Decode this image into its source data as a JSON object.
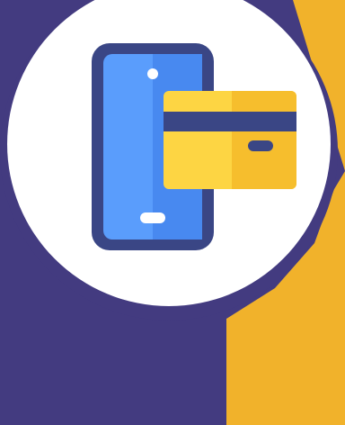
{
  "illustration": {
    "icon": "mobile-card-payment-icon",
    "elements": [
      "smartphone-icon",
      "credit-card-icon"
    ]
  },
  "colors": {
    "background_purple": "#433b80",
    "accent_yellow": "#f1b22b",
    "circle_white": "#ffffff",
    "phone_frame": "#3a4685",
    "phone_screen": "#5a9dfc",
    "phone_screen_shade": "#4889f0",
    "card_yellow": "#fdd543",
    "card_shade": "#f6be2d",
    "card_stripe": "#3a4685"
  }
}
